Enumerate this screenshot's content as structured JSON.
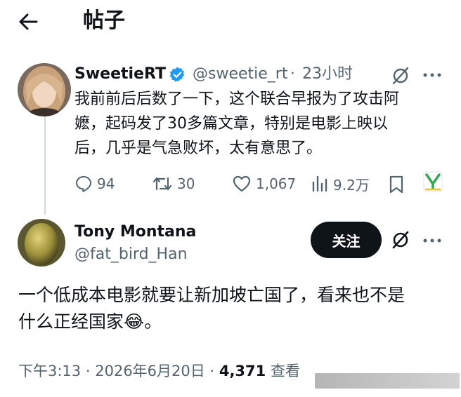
{
  "header": {
    "back_icon": "arrow-left-icon",
    "title": "帖子"
  },
  "post1": {
    "display_name": "SweetieRT",
    "verified_icon": "verified-badge-icon",
    "handle": "@sweetie_rt",
    "separator": "·",
    "time": "23小时",
    "text": "我前前后后数了一下，这个联合早报为了攻击阿\n嬷，起码发了30多篇文章，特别是电影上映以\n后，几乎是气急败坏，太有意思了。",
    "stats": {
      "replies": "94",
      "retweets": "30",
      "likes": "1,067",
      "views": "9.2万"
    }
  },
  "post2": {
    "display_name": "Tony Montana",
    "handle": "@fat_bird_Han",
    "follow_label": "关注",
    "text": "一个低成本电影就要让新加坡亡国了，看来也不是\n什么正经国家😂。",
    "time": "下午3:13",
    "separator": "·",
    "date": "2026年6月20日",
    "views_count": "4,371",
    "views_label": "查看"
  },
  "colors": {
    "text": "#0f1419",
    "muted": "#536471",
    "verified": "#1d9bf0",
    "follow_bg": "#0f1419",
    "badge_green": "#2ea94f"
  }
}
